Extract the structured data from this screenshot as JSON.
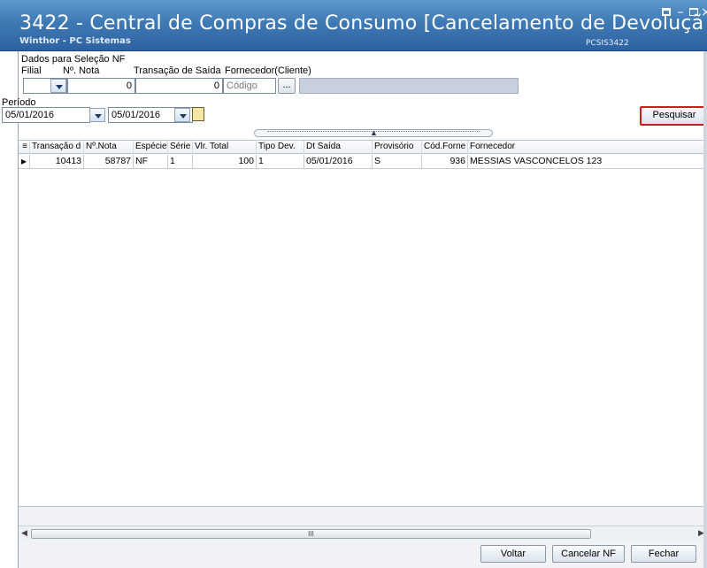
{
  "window": {
    "title": "3422 - Central de Compras de Consumo [Cancelamento de Devoluçã",
    "subtitle": "Winthor - PC Sistemas",
    "code": "PCSIS3422"
  },
  "form": {
    "group_label": "Dados para Seleção NF",
    "filial_label": "Filial",
    "nota_label": "Nº. Nota",
    "transacao_label": "Transação de Saída",
    "fornecedor_label": "Fornecedor(Cliente)",
    "nota_value": "0",
    "transacao_value": "0",
    "fornecedor_placeholder": "Código",
    "browse_label": "...",
    "periodo_label": "Período",
    "date_start": "05/01/2016",
    "date_end": "05/01/2016",
    "search_button": "Pesquisar"
  },
  "grid": {
    "columns": [
      "Transação d",
      "Nº.Nota",
      "Espécie",
      "Série",
      "Vlr. Total",
      "Tipo Dev.",
      "Dt Saída",
      "Provisório",
      "Cód.Forne",
      "Fornecedor"
    ],
    "rows": [
      {
        "transacao": "10413",
        "nota": "58787",
        "especie": "NF",
        "serie": "1",
        "vlr_total": "100",
        "tipo_dev": "1",
        "dt_saida": "05/01/2016",
        "provisorio": "S",
        "cod_forne": "936",
        "fornecedor": "MESSIAS VASCONCELOS 123"
      }
    ],
    "scroll_grip": "III"
  },
  "buttons": {
    "voltar": "Voltar",
    "cancelar": "Cancelar NF",
    "fechar": "Fechar"
  },
  "colors": {
    "title_bar": "#3f79b4",
    "highlight": "#d11b1b"
  }
}
